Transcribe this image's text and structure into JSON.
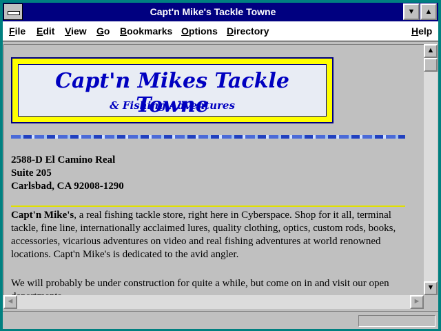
{
  "window": {
    "title": "Capt'n Mike's Tackle Towne"
  },
  "menu": {
    "items": [
      "File",
      "Edit",
      "View",
      "Go",
      "Bookmarks",
      "Options",
      "Directory",
      "Help"
    ]
  },
  "logo": {
    "title": "Capt'n Mikes Tackle Towne",
    "subtitle": "& Fishing Adventures"
  },
  "address": {
    "line1": "2588-D El Camino Real",
    "line2": "Suite 205",
    "line3": "Carlsbad, CA 92008-1290"
  },
  "intro": {
    "bold": "Capt'n Mike's",
    "text": ", a real fishing tackle store, right here in Cyberspace. Shop for it all, terminal tackle, fine line, internationally acclaimed lures, quality clothing, optics, custom rods, books, accessories, vicarious adventures on video and real fishing adventures at world renowned locations. Capt'n Mike's is dedicated to the avid angler."
  },
  "construction": {
    "text": "We will probably be under construction for quite a while, but come on in and visit our open departments."
  },
  "icons": {
    "up": "▲",
    "down": "▼",
    "scroll_up": "▲",
    "scroll_down": "▼",
    "left": "◄",
    "right": "►"
  }
}
